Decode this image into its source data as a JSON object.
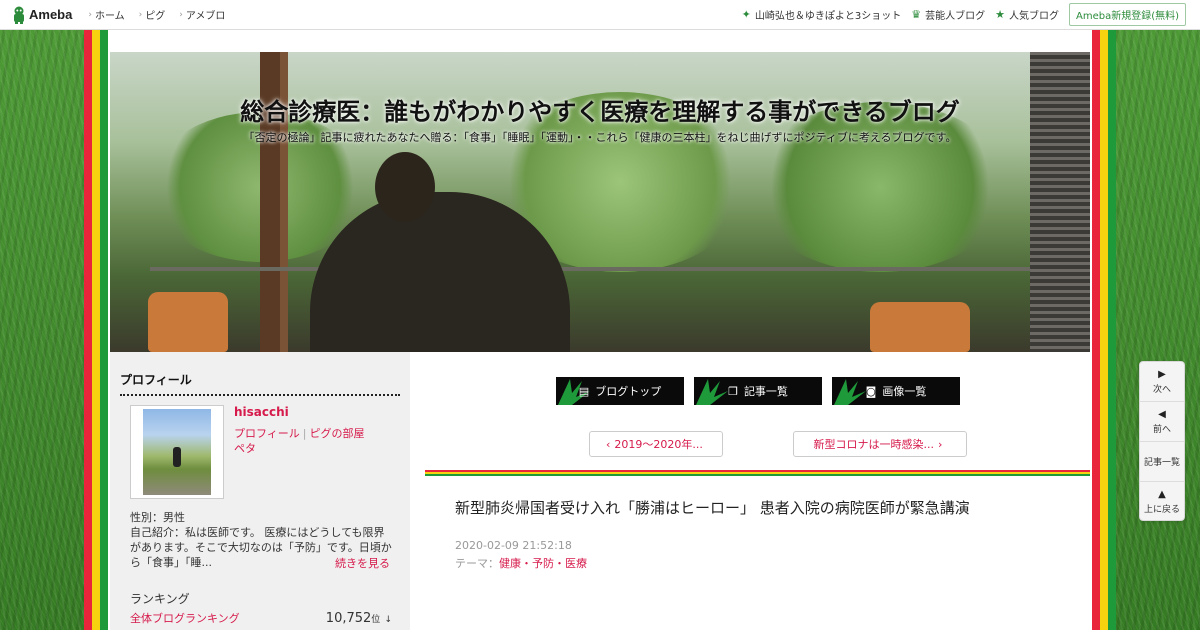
{
  "topbar": {
    "logo_text": "Ameba",
    "nav": [
      {
        "label": "ホーム"
      },
      {
        "label": "ピグ"
      },
      {
        "label": "アメブロ"
      }
    ],
    "right_links": [
      {
        "label": "山崎弘也＆ゆきぽよと3ショット",
        "icon": "sparkle-icon"
      },
      {
        "label": "芸能人ブログ",
        "icon": "crown-icon"
      },
      {
        "label": "人気ブログ",
        "icon": "star-icon"
      }
    ],
    "register_label": "Ameba新規登録(無料)",
    "accent_color": "#2d8c3c"
  },
  "header": {
    "title": "総合診療医：誰もがわかりやすく医療を理解する事ができるブログ",
    "description": "「否定の極論」記事に疲れたあなたへ贈る：「食事」「睡眠」「運動」・・これら「健康の三本柱」をねじ曲げずにポジティブに考えるブログです。"
  },
  "sidebar": {
    "heading": "プロフィール",
    "name": "hisacchi",
    "link_profile": "プロフィール",
    "link_pig": "ピグの部屋",
    "link_peta": "ペタ",
    "gender": "性別：男性",
    "intro": "自己紹介：私は医師です。 医療にはどうしても限界があります。そこで大切なのは「予防」です。日頃から「食事」「睡...",
    "read_more": "続きを見る",
    "ranking_title": "ランキング",
    "ranking_label": "全体ブログランキング",
    "ranking_value": "10,752",
    "ranking_unit": "位",
    "ranking_trend": "↓"
  },
  "main": {
    "tabs": [
      {
        "label": "ブログトップ",
        "icon": "document-icon"
      },
      {
        "label": "記事一覧",
        "icon": "copy-icon"
      },
      {
        "label": "画像一覧",
        "icon": "camera-icon"
      }
    ],
    "prev_label": "2019～2020年...",
    "next_label": "新型コロナは一時感染...",
    "article_title": "新型肺炎帰国者受け入れ「勝浦はヒーロー」 患者入院の病院医師が緊急講演",
    "article_date": "2020-02-09 21:52:18",
    "theme_prefix": "テーマ：",
    "theme_label": "健康・予防・医療",
    "accent_color": "#d61a4b"
  },
  "float_nav": [
    {
      "label": "次へ",
      "icon": "triangle-right-icon"
    },
    {
      "label": "前へ",
      "icon": "triangle-left-icon"
    },
    {
      "label": "記事一覧",
      "icon": ""
    },
    {
      "label": "上に戻る",
      "icon": "triangle-up-icon"
    }
  ]
}
